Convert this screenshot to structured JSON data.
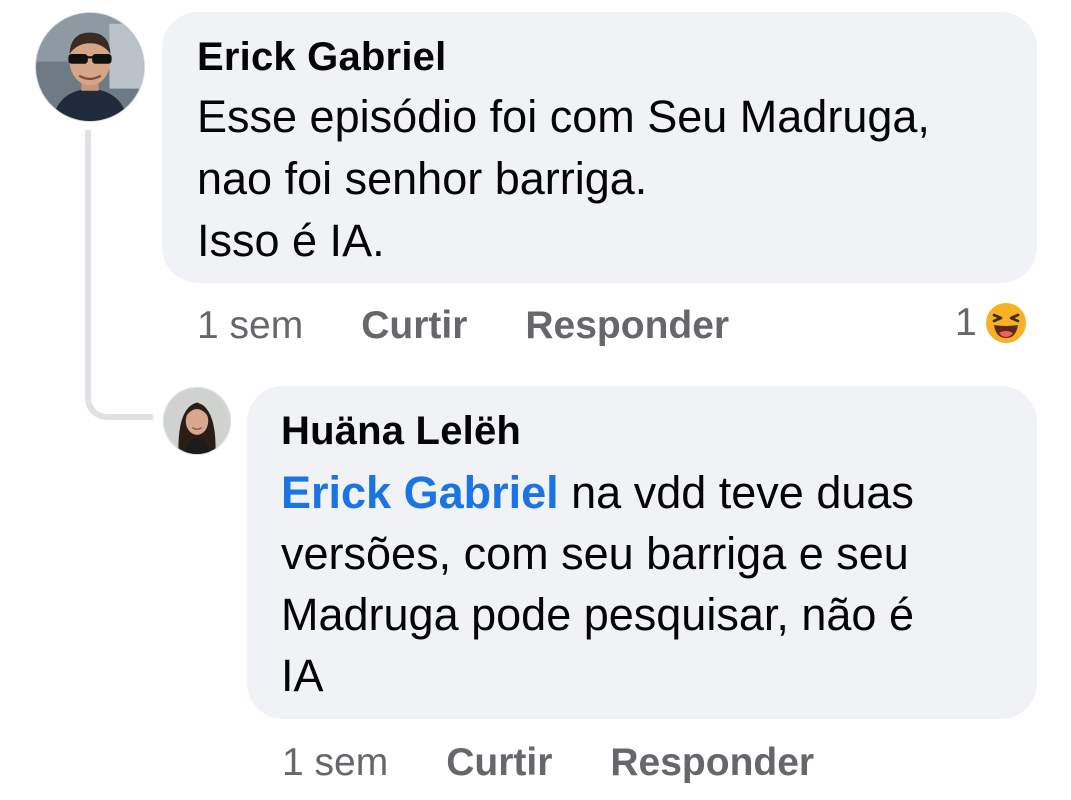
{
  "comments": [
    {
      "author": "Erick Gabriel",
      "text": "Esse episódio foi com Seu Madruga,\nnao foi senhor barriga.\nIsso é IA.",
      "time": "1 sem",
      "like_label": "Curtir",
      "reply_label": "Responder",
      "reaction_count": "1",
      "reaction_icon": "laughing-emoji-icon"
    }
  ],
  "reply": {
    "author": "Huäna Lelëh",
    "mention": "Erick Gabriel",
    "text": " na vdd teve duas\nversões, com seu barriga e seu\nMadruga pode pesquisar, não é\nIA",
    "time": "1 sem",
    "like_label": "Curtir",
    "reply_label": "Responder"
  },
  "colors": {
    "bubble": "#f0f2f5",
    "secondary_text": "#65676b",
    "mention": "#1b74e4",
    "thread_line": "#dfe1e5"
  }
}
